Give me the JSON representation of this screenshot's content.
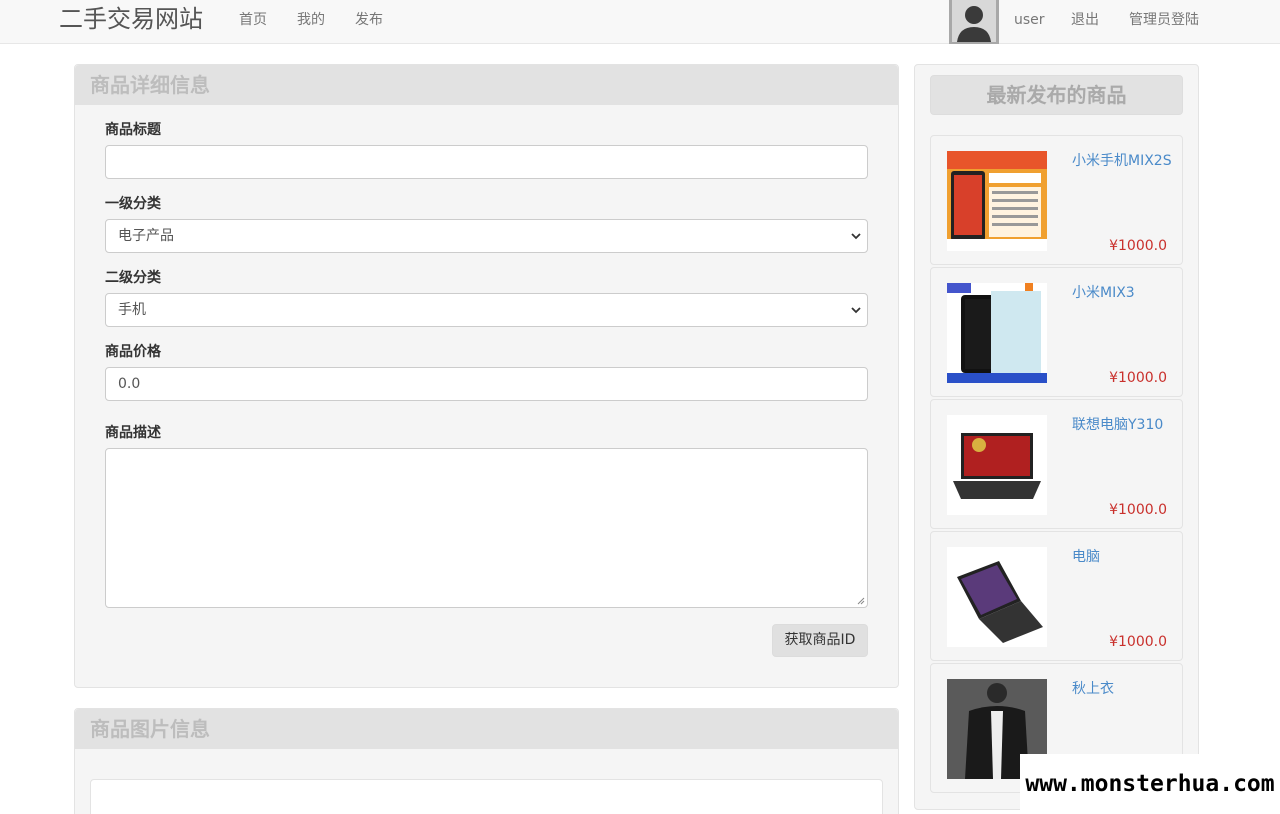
{
  "navbar": {
    "brand": "二手交易网站",
    "links": [
      "首页",
      "我的",
      "发布"
    ],
    "user": "user",
    "logout": "退出",
    "admin_login": "管理员登陆"
  },
  "detail_panel": {
    "title": "商品详细信息",
    "title_label": "商品标题",
    "title_value": "",
    "category1_label": "一级分类",
    "category1_value": "电子产品",
    "category2_label": "二级分类",
    "category2_value": "手机",
    "price_label": "商品价格",
    "price_value": "0.0",
    "desc_label": "商品描述",
    "get_id_button": "获取商品ID"
  },
  "image_panel": {
    "title": "商品图片信息"
  },
  "sidebar": {
    "title": "最新发布的商品",
    "items": [
      {
        "name": "小米手机MIX2S",
        "price": "¥1000.0"
      },
      {
        "name": "小米MIX3",
        "price": "¥1000.0"
      },
      {
        "name": "联想电脑Y310",
        "price": "¥1000.0"
      },
      {
        "name": "电脑",
        "price": "¥1000.0"
      },
      {
        "name": "秋上衣",
        "price": ""
      }
    ]
  },
  "watermark": "www.monsterhua.com"
}
